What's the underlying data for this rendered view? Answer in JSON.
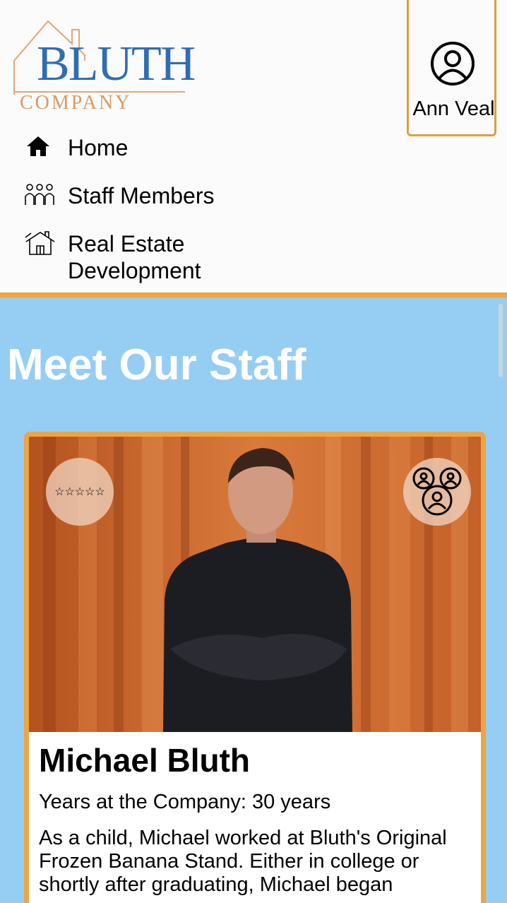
{
  "logo": {
    "line1": "BLUTH",
    "line2": "COMPANY"
  },
  "nav": {
    "items": [
      {
        "label": "Home",
        "icon": "home-icon"
      },
      {
        "label": "Staff Members",
        "icon": "people-icon"
      },
      {
        "label": "Real Estate Development",
        "icon": "house-building-icon"
      }
    ]
  },
  "user": {
    "name": "Ann Veal",
    "icon": "user-circle-icon"
  },
  "main": {
    "title": "Meet Our Staff"
  },
  "card": {
    "rating_stars": "☆☆☆☆☆",
    "rating_icon": "star-rating-icon",
    "team_icon": "team-group-icon",
    "name": "Michael Bluth",
    "years": "Years at the Company: 30 years",
    "bio": "As a child, Michael worked at Bluth's Original Frozen Banana Stand. Either in college or shortly after graduating, Michael began"
  },
  "colors": {
    "accent": "#eda544",
    "main_bg": "#96cdf3",
    "logo_blue": "#2f6db5",
    "logo_orange": "#d99a66"
  }
}
